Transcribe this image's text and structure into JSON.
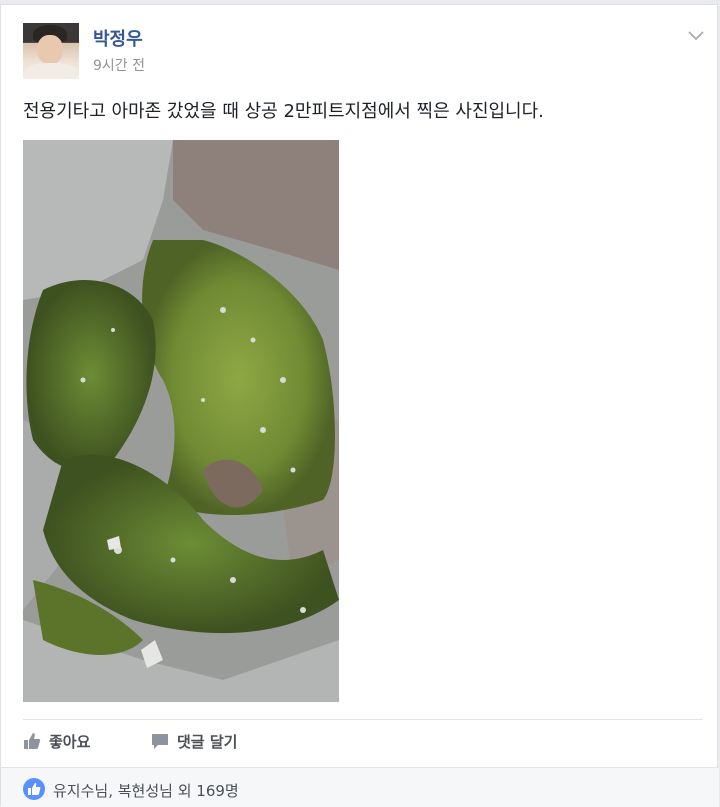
{
  "post": {
    "author": "박정우",
    "time": "9시간 전",
    "text": "전용기타고 아마존 갔었을 때 상공 2만피트지점에서 찍은 사진입니다."
  },
  "photo": {
    "icon": "moss-photo"
  },
  "actions": {
    "like_label": "좋아요",
    "comment_label": "댓글 달기"
  },
  "reactions": {
    "summary": "유지수님, 복현성님 외 169명"
  },
  "colors": {
    "link": "#365899",
    "like_icon": "#5890ff",
    "muted": "#90949c"
  }
}
